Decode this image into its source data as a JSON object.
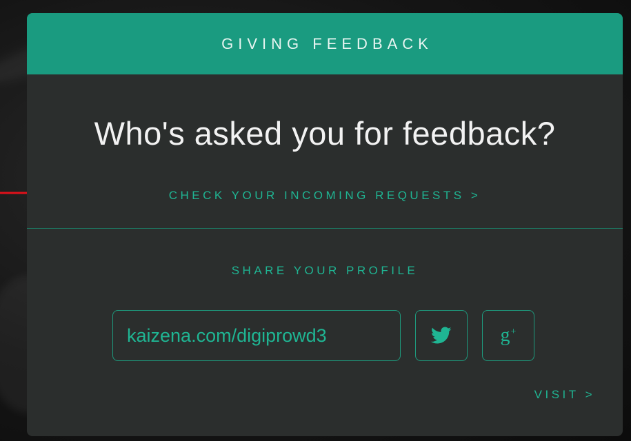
{
  "header": {
    "title": "GIVING FEEDBACK"
  },
  "prompt": {
    "question": "Who's asked you for feedback?",
    "requests_link": "CHECK YOUR INCOMING REQUESTS >"
  },
  "share": {
    "label": "SHARE YOUR PROFILE",
    "profile_url": "kaizena.com/digiprowd3",
    "twitter_icon": "twitter-bird-icon",
    "gplus_icon": "google-plus-icon",
    "gplus_glyph": "g",
    "gplus_plus": "+",
    "visit_link": "VISIT >"
  },
  "colors": {
    "accent": "#1a9b80",
    "accent_text": "#1fb593",
    "card_bg": "#2b2e2d",
    "annotation": "#e0101a"
  }
}
